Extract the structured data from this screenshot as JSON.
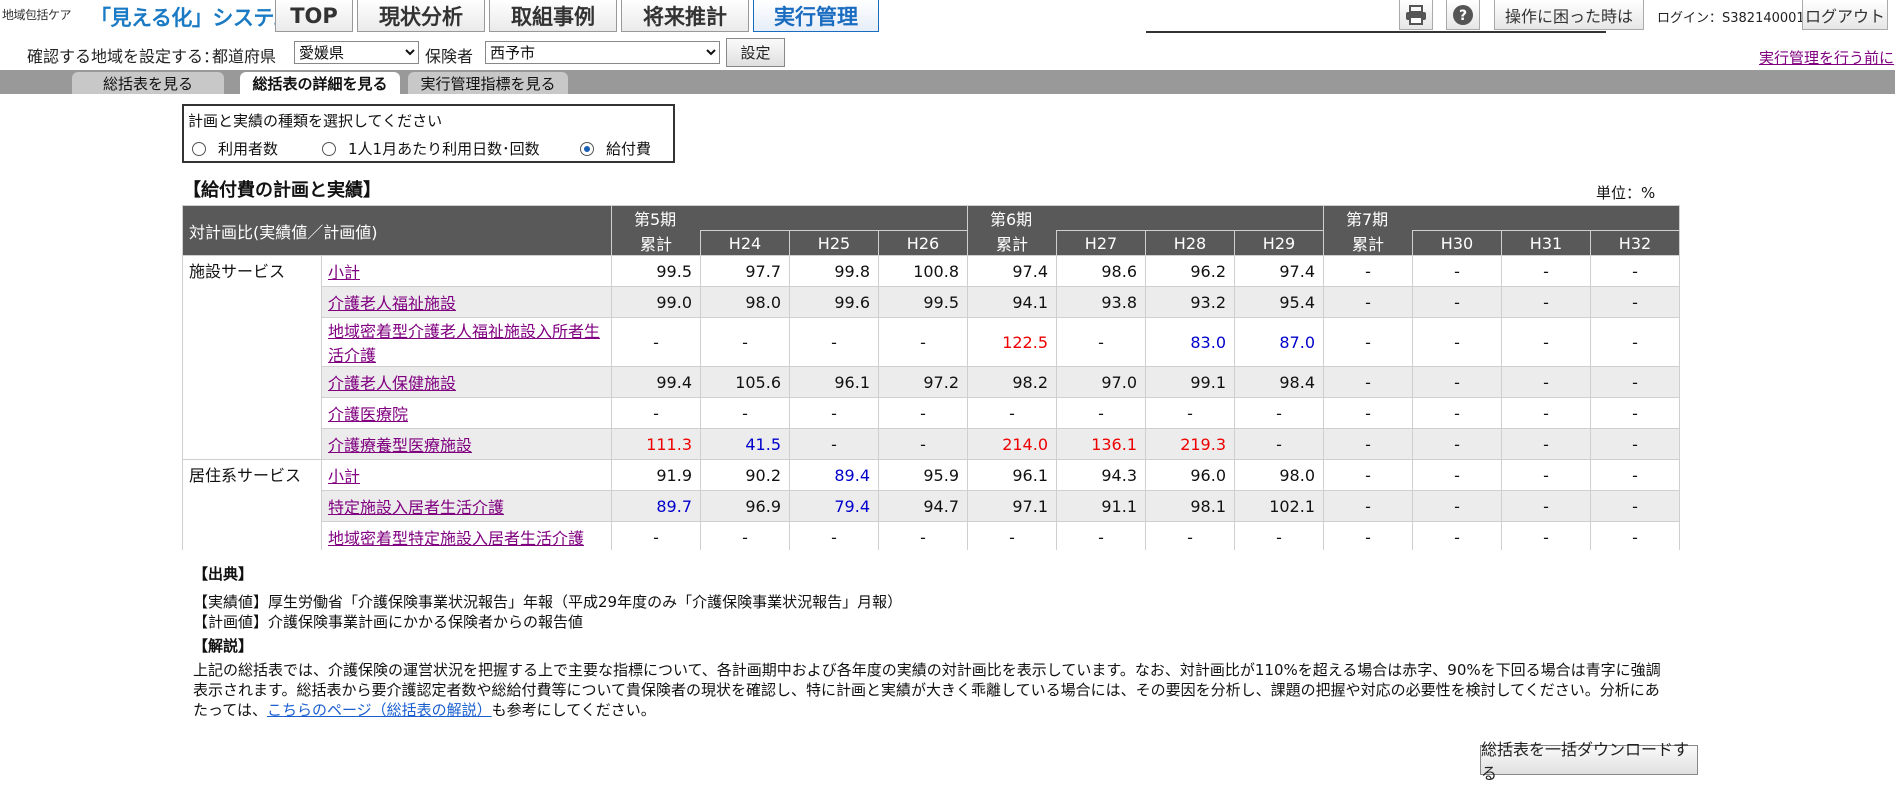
{
  "header": {
    "brand_small": "地域包括ケア",
    "brand_main": "「見える化」システム",
    "nav": [
      {
        "label": "TOP"
      },
      {
        "label": "現状分析"
      },
      {
        "label": "取組事例"
      },
      {
        "label": "将来推計"
      },
      {
        "label": "実行管理"
      }
    ],
    "help_label": "操作に困った時は",
    "login_text": "ログイン：S382140001",
    "logout_label": "ログアウト",
    "icons": [
      "printer-icon",
      "help-icon"
    ]
  },
  "region": {
    "prompt": "確認する地域を設定する：",
    "pref_label": "都道府県",
    "pref_value": "愛媛県",
    "insurer_label": "保険者",
    "insurer_value": "西予市",
    "set_label": "設定",
    "exec_link": "実行管理を行う前に"
  },
  "subtabs": [
    {
      "label": "総括表を見る"
    },
    {
      "label": "総括表の詳細を見る"
    },
    {
      "label": "実行管理指標を見る"
    }
  ],
  "type_select": {
    "question": "計画と実績の種類を選択してください",
    "options": [
      {
        "label": "利用者数",
        "selected": false
      },
      {
        "label": "1人1月あたり利用日数･回数",
        "selected": false
      },
      {
        "label": "給付費",
        "selected": true
      }
    ]
  },
  "section_title": "【給付費の計画と実績】",
  "unit": "単位：%",
  "table": {
    "corner": "対計画比(実績値／計画値)",
    "periods": [
      "第5期",
      "第6期",
      "第7期"
    ],
    "subcols": [
      "累計",
      "H24",
      "H25",
      "H26",
      "累計",
      "H27",
      "H28",
      "H29",
      "累計",
      "H30",
      "H31",
      "H32"
    ],
    "groups": [
      {
        "category": "施設サービス",
        "rows": [
          {
            "name": "小計",
            "values": [
              "99.5",
              "97.7",
              "99.8",
              "100.8",
              "97.4",
              "98.6",
              "96.2",
              "97.4",
              "-",
              "-",
              "-",
              "-"
            ],
            "colors": [
              "",
              "",
              "",
              "",
              "",
              "",
              "",
              "",
              "",
              "",
              "",
              ""
            ]
          },
          {
            "name": "介護老人福祉施設",
            "values": [
              "99.0",
              "98.0",
              "99.6",
              "99.5",
              "94.1",
              "93.8",
              "93.2",
              "95.4",
              "-",
              "-",
              "-",
              "-"
            ],
            "colors": [
              "",
              "",
              "",
              "",
              "",
              "",
              "",
              "",
              "",
              "",
              "",
              ""
            ]
          },
          {
            "name": "地域密着型介護老人福祉施設入所者生活介護",
            "values": [
              "-",
              "-",
              "-",
              "-",
              "122.5",
              "-",
              "83.0",
              "87.0",
              "-",
              "-",
              "-",
              "-"
            ],
            "colors": [
              "",
              "",
              "",
              "",
              "red",
              "",
              "blue",
              "blue",
              "",
              "",
              "",
              ""
            ]
          },
          {
            "name": "介護老人保健施設",
            "values": [
              "99.4",
              "105.6",
              "96.1",
              "97.2",
              "98.2",
              "97.0",
              "99.1",
              "98.4",
              "-",
              "-",
              "-",
              "-"
            ],
            "colors": [
              "",
              "",
              "",
              "",
              "",
              "",
              "",
              "",
              "",
              "",
              "",
              ""
            ]
          },
          {
            "name": "介護医療院",
            "values": [
              "-",
              "-",
              "-",
              "-",
              "-",
              "-",
              "-",
              "-",
              "-",
              "-",
              "-",
              "-"
            ],
            "colors": [
              "",
              "",
              "",
              "",
              "",
              "",
              "",
              "",
              "",
              "",
              "",
              ""
            ]
          },
          {
            "name": "介護療養型医療施設",
            "values": [
              "111.3",
              "41.5",
              "-",
              "-",
              "214.0",
              "136.1",
              "219.3",
              "-",
              "-",
              "-",
              "-",
              "-"
            ],
            "colors": [
              "red",
              "blue",
              "",
              "",
              "red",
              "red",
              "red",
              "",
              "",
              "",
              "",
              ""
            ]
          }
        ]
      },
      {
        "category": "居住系サービス",
        "rows": [
          {
            "name": "小計",
            "values": [
              "91.9",
              "90.2",
              "89.4",
              "95.9",
              "96.1",
              "94.3",
              "96.0",
              "98.0",
              "-",
              "-",
              "-",
              "-"
            ],
            "colors": [
              "",
              "",
              "blue",
              "",
              "",
              "",
              "",
              "",
              "",
              "",
              "",
              ""
            ]
          },
          {
            "name": "特定施設入居者生活介護",
            "values": [
              "89.7",
              "96.9",
              "79.4",
              "94.7",
              "97.1",
              "91.1",
              "98.1",
              "102.1",
              "-",
              "-",
              "-",
              "-"
            ],
            "colors": [
              "blue",
              "",
              "blue",
              "",
              "",
              "",
              "",
              "",
              "",
              "",
              "",
              ""
            ]
          },
          {
            "name": "地域密着型特定施設入居者生活介護",
            "values": [
              "-",
              "-",
              "-",
              "-",
              "-",
              "-",
              "-",
              "-",
              "-",
              "-",
              "-",
              "-"
            ],
            "colors": [
              "",
              "",
              "",
              "",
              "",
              "",
              "",
              "",
              "",
              "",
              "",
              ""
            ]
          }
        ]
      }
    ]
  },
  "notes": {
    "source_heading": "【出典】",
    "source_1": "【実績値】厚生労働省「介護保険事業状況報告」年報（平成29年度のみ「介護保険事業状況報告」月報）",
    "source_2": "【計画値】介護保険事業計画にかかる保険者からの報告値",
    "explain_heading": "【解説】",
    "explain_text": "上記の総括表では、介護保険の運営状況を把握する上で主要な指標について、各計画期中および各年度の実績の対計画比を表示しています。なお、対計画比が110%を超える場合は赤字、90%を下回る場合は青字に強調表示されます。総括表から要介護認定者数や総給付費等について貴保険者の現状を確認し、特に計画と実績が大きく乖離している場合には、その要因を分析し、課題の把握や対応の必要性を検討してください。分析にあたっては、",
    "explain_link": "こちらのページ（総括表の解説）",
    "explain_tail": "も参考にしてください。"
  },
  "download_label": "総括表を一括ダウンロードする"
}
